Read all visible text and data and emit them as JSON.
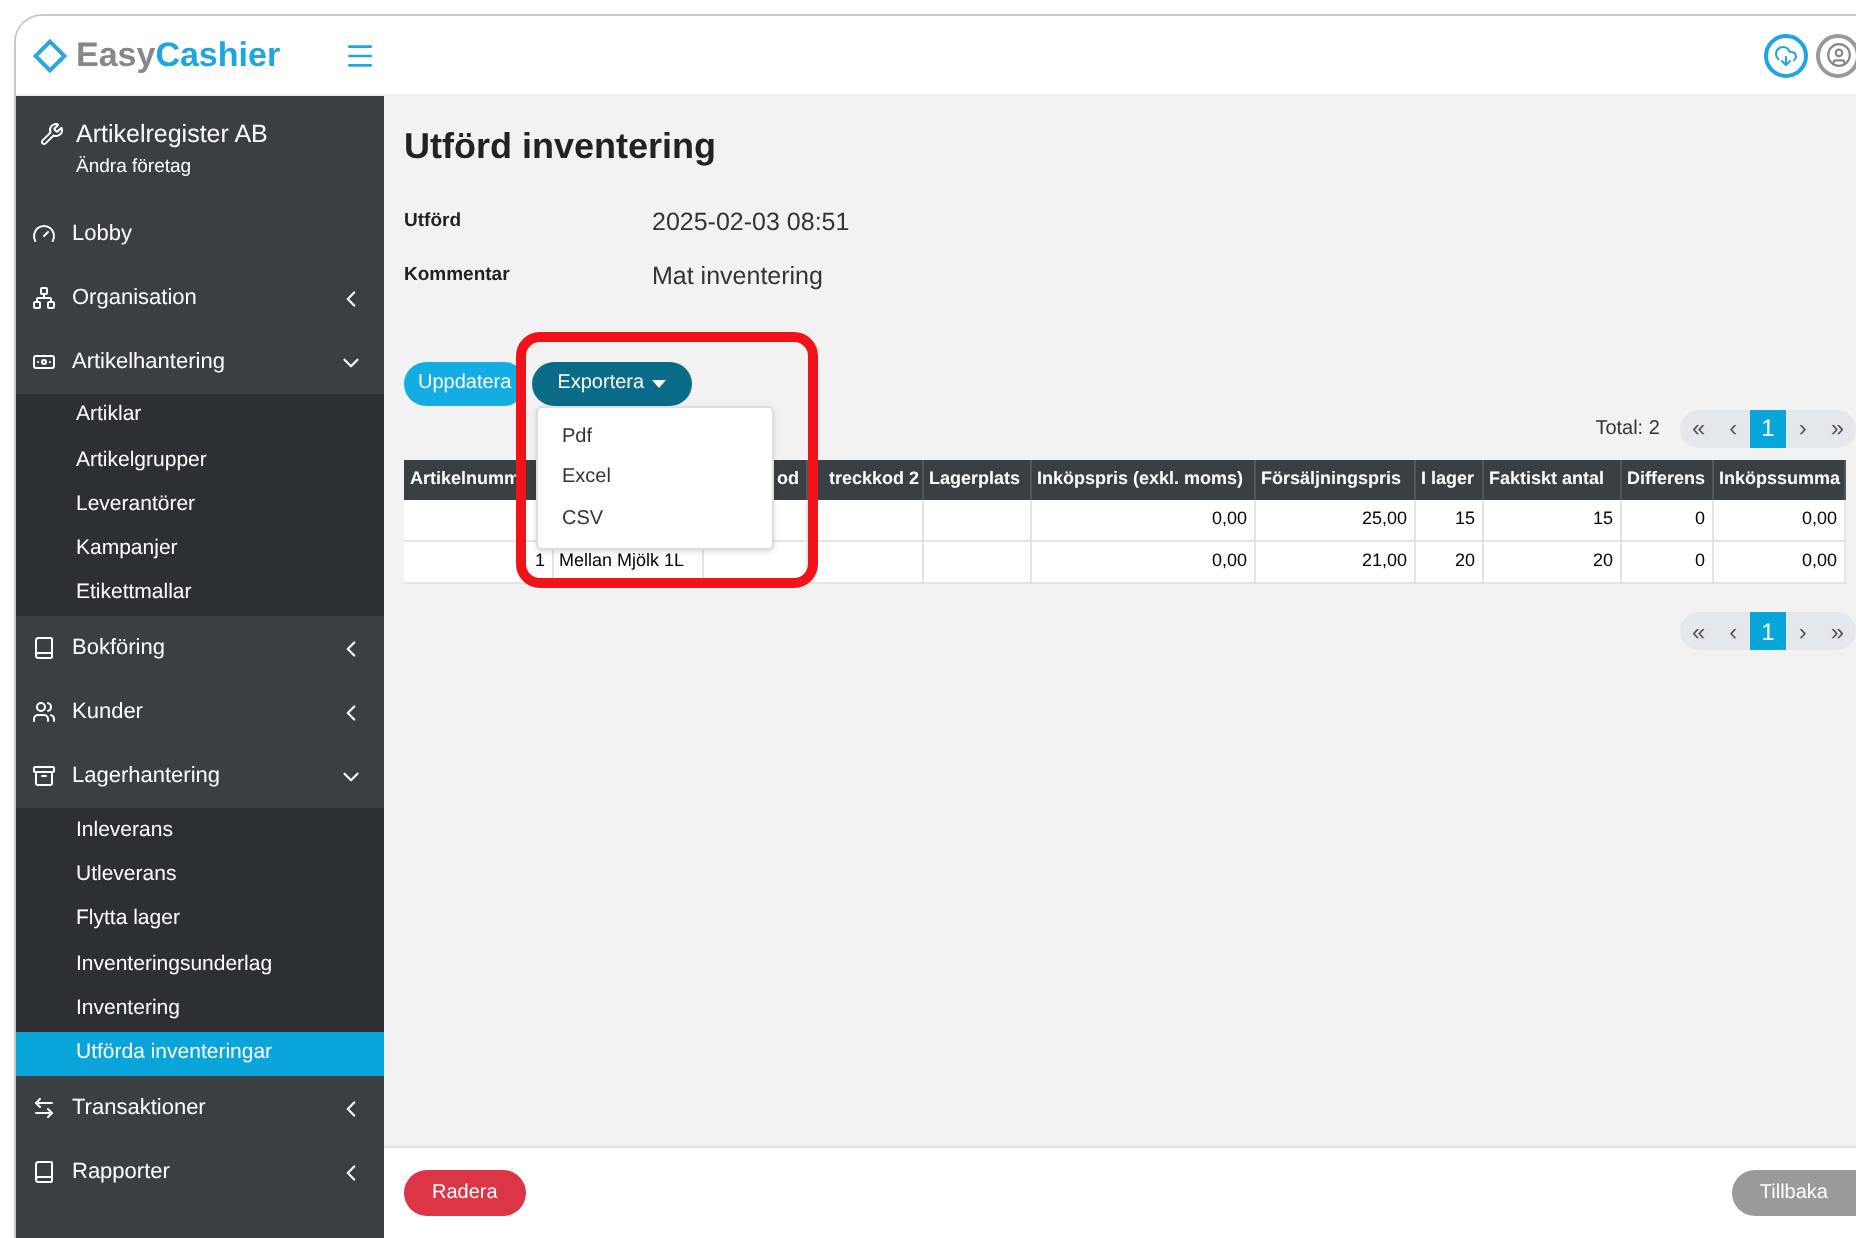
{
  "brand": {
    "first": "Easy",
    "second": "Cashier"
  },
  "company": {
    "name": "Artikelregister AB",
    "link": "Ändra företag"
  },
  "sidebar": {
    "items": [
      {
        "kind": "link",
        "label": "Lobby"
      },
      {
        "kind": "group",
        "label": "Organisation",
        "expanded": false
      },
      {
        "kind": "group",
        "label": "Artikelhantering",
        "expanded": true,
        "children": [
          {
            "label": "Artiklar",
            "selected": false
          },
          {
            "label": "Artikelgrupper",
            "selected": false
          },
          {
            "label": "Leverantörer",
            "selected": false
          },
          {
            "label": "Kampanjer",
            "selected": false
          },
          {
            "label": "Etikettmallar",
            "selected": false
          }
        ]
      },
      {
        "kind": "group",
        "label": "Bokföring",
        "expanded": false
      },
      {
        "kind": "group",
        "label": "Kunder",
        "expanded": false
      },
      {
        "kind": "group",
        "label": "Lagerhantering",
        "expanded": true,
        "children": [
          {
            "label": "Inleverans",
            "selected": false
          },
          {
            "label": "Utleverans",
            "selected": false
          },
          {
            "label": "Flytta lager",
            "selected": false
          },
          {
            "label": "Inventeringsunderlag",
            "selected": false
          },
          {
            "label": "Inventering",
            "selected": false
          },
          {
            "label": "Utförda inventeringar",
            "selected": true
          }
        ]
      },
      {
        "kind": "group",
        "label": "Transaktioner",
        "expanded": false
      },
      {
        "kind": "group",
        "label": "Rapporter",
        "expanded": false
      }
    ]
  },
  "page": {
    "title": "Utförd inventering",
    "fields": [
      {
        "label": "Utförd",
        "value": "2025-02-03 08:51"
      },
      {
        "label": "Kommentar",
        "value": "Mat inventering"
      }
    ],
    "buttons": {
      "update": "Uppdatera",
      "export": "Exportera"
    },
    "export_menu": {
      "open": true,
      "items": [
        "Pdf",
        "Excel",
        "CSV"
      ]
    },
    "total": "Total: 2",
    "pagination_top": {
      "first": "«",
      "prev": "‹",
      "pages": [
        {
          "label": "1",
          "selected": true
        }
      ],
      "next": "›",
      "last": "»"
    },
    "pagination_bottom": {
      "first": "«",
      "prev": "‹",
      "pages": [
        {
          "label": "1",
          "selected": true
        }
      ],
      "next": "›",
      "last": "»"
    },
    "table": {
      "columns": [
        "Artikelnumm",
        null,
        "od",
        "treckkod 2",
        "Lagerplats",
        "Inköpspris (exkl. moms)",
        "Försäljningspris",
        "I lager",
        "Faktiskt antal",
        "Differens",
        "Inköpssumma"
      ],
      "rows": [
        [
          null,
          null,
          null,
          null,
          null,
          "0,00",
          "25,00",
          "15",
          "15",
          "0",
          "0,00"
        ],
        [
          "1",
          "Mellan Mjölk 1L",
          null,
          null,
          null,
          "0,00",
          "21,00",
          "20",
          "20",
          "0",
          "0,00"
        ]
      ]
    },
    "footer": {
      "delete": "Radera",
      "back": "Tillbaka"
    }
  },
  "annotation": {
    "highlight": true
  }
}
